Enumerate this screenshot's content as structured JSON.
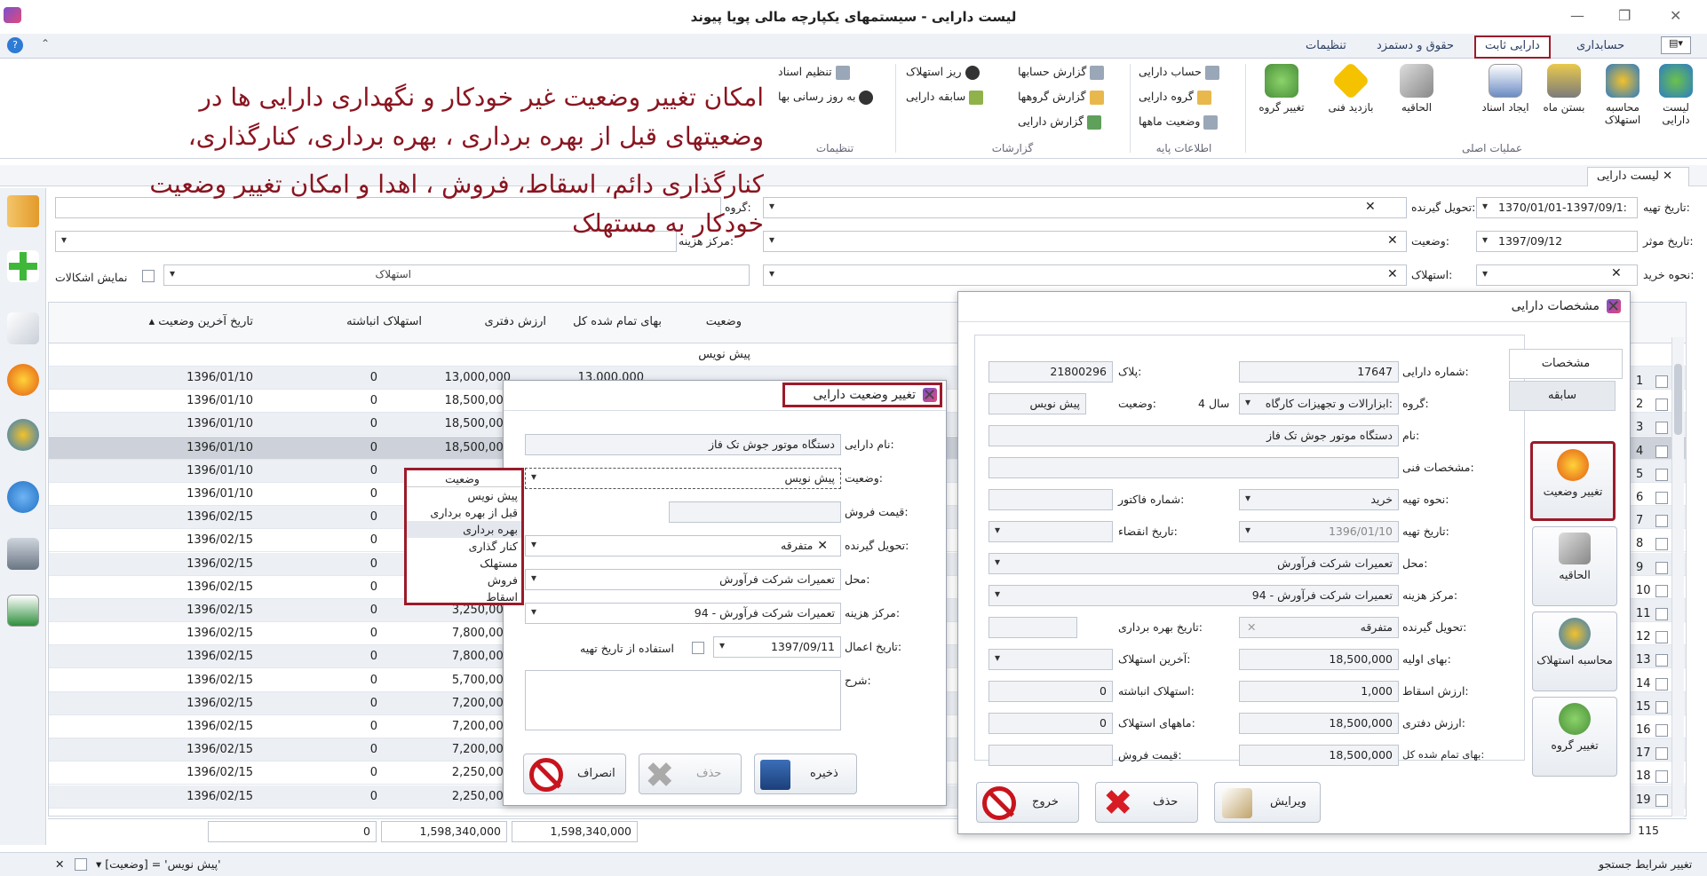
{
  "window": {
    "title": "لیست دارایی - سیستمهای یکپارچه مالی پویا پیوند"
  },
  "menu": {
    "tabs": [
      "حسابداری",
      "دارایی ثابت",
      "حقوق و دستمزد",
      "تنظیمات"
    ]
  },
  "ribbon": {
    "main_ops": [
      "لیست دارایی",
      "محاسبه استهلاک",
      "بستن ماه",
      "ایجاد اسناد",
      "الحاقیه",
      "بازدید فنی",
      "تغییر گروه"
    ],
    "main_ops_label": "عملیات اصلی",
    "base_info": [
      "حساب دارایی",
      "گروه دارایی",
      "وضعیت ماهها"
    ],
    "base_info_label": "اطلاعات پایه",
    "reports": [
      "گزارش حسابها",
      "گزارش گروهها",
      "گزارش دارایی",
      "ریز استهلاک",
      "سابقه دارایی"
    ],
    "reports_label": "گزارشات",
    "settings": [
      "تنظیم اسناد",
      "به روز رسانی بها"
    ],
    "settings_label": "تنظیمات"
  },
  "doc_tab": "لیست دارایی",
  "filters": {
    "prep_date_label": "تاریخ تهیه:",
    "prep_date": "1370/01/01-1397/09/1:",
    "effective_date_label": "تاریخ موثر:",
    "effective_date": "1397/09/12",
    "purchase_label": "نحوه خرید:",
    "receiver_label": "تحویل گیرنده:",
    "status_label": "وضعیت:",
    "depreciation_label": "استهلاک:",
    "group_label": "گروه:",
    "cost_center_label": "مرکز هزینه:",
    "show_issues": "نمایش اشکالات",
    "depreciation_text": "استهلاک"
  },
  "annotation": [
    "امکان تغییر وضعیت  غیر خودکار و نگهداری دارایی ها در",
    "وضعیتهای قبل از بهره برداری ، بهره برداری، کنارگذاری،",
    "کنارگذاری دائم، اسقاط، فروش ، اهدا و امکان تغییر وضعیت",
    "خودکار به مستهلک"
  ],
  "grid": {
    "headers": {
      "last_status_date": "تاریخ آخرین وضعیت",
      "acc_depr": "استهلاک انباشته",
      "book_value": "ارزش دفتری",
      "total_cost": "بهای تمام شده کل",
      "status": "وضعیت"
    },
    "filter_row_status": "پیش نویس",
    "rows": [
      {
        "n": "1",
        "date": "1396/01/10",
        "acc": "0",
        "book": "13,000,000",
        "cost": "13,000,000"
      },
      {
        "n": "2",
        "date": "1396/01/10",
        "acc": "0",
        "book": "18,500,000",
        "cost": ""
      },
      {
        "n": "3",
        "date": "1396/01/10",
        "acc": "0",
        "book": "18,500,000",
        "cost": ""
      },
      {
        "n": "4",
        "date": "1396/01/10",
        "acc": "0",
        "book": "18,500,000",
        "cost": ""
      },
      {
        "n": "5",
        "date": "1396/01/10",
        "acc": "0",
        "book": "8",
        "cost": ""
      },
      {
        "n": "6",
        "date": "1396/01/10",
        "acc": "0",
        "book": "8",
        "cost": ""
      },
      {
        "n": "7",
        "date": "1396/02/15",
        "acc": "0",
        "book": "19",
        "cost": ""
      },
      {
        "n": "8",
        "date": "1396/02/15",
        "acc": "0",
        "book": "3",
        "cost": ""
      },
      {
        "n": "9",
        "date": "1396/02/15",
        "acc": "0",
        "book": "3",
        "cost": ""
      },
      {
        "n": "10",
        "date": "1396/02/15",
        "acc": "0",
        "book": "3",
        "cost": ""
      },
      {
        "n": "11",
        "date": "1396/02/15",
        "acc": "0",
        "book": "3,250,000",
        "cost": ""
      },
      {
        "n": "12",
        "date": "1396/02/15",
        "acc": "0",
        "book": "7,800,000",
        "cost": ""
      },
      {
        "n": "13",
        "date": "1396/02/15",
        "acc": "0",
        "book": "7,800,000",
        "cost": ""
      },
      {
        "n": "14",
        "date": "1396/02/15",
        "acc": "0",
        "book": "5,700,000",
        "cost": ""
      },
      {
        "n": "15",
        "date": "1396/02/15",
        "acc": "0",
        "book": "7,200,000",
        "cost": ""
      },
      {
        "n": "16",
        "date": "1396/02/15",
        "acc": "0",
        "book": "7,200,000",
        "cost": ""
      },
      {
        "n": "17",
        "date": "1396/02/15",
        "acc": "0",
        "book": "7,200,000",
        "cost": ""
      },
      {
        "n": "18",
        "date": "1396/02/15",
        "acc": "0",
        "book": "2,250,000",
        "cost": ""
      },
      {
        "n": "19",
        "date": "1396/02/15",
        "acc": "0",
        "book": "2,250,000",
        "cost": "2,250,000",
        "status": "پیش نویس"
      }
    ],
    "totals": {
      "acc": "0",
      "book": "1,598,340,000",
      "cost": "1,598,340,000",
      "count": "115"
    }
  },
  "status_bar": {
    "filter": "[وضعیت] = 'پیش نویس'",
    "edit": "تغییر شرایط جستجو"
  },
  "change_dialog": {
    "title": "تغییر وضعیت دارایی",
    "name_label": "نام دارایی:",
    "name": "دستگاه موتور جوش تک فاز",
    "status_label": "وضعیت:",
    "status": "پیش نویس",
    "sale_label": "قیمت فروش:",
    "receiver_label": "تحویل گیرنده:",
    "receiver": "متفرقه",
    "location_label": "محل:",
    "location": "تعمیرات شرکت فرآورش",
    "cost_center_label": "مرکز هزینه:",
    "cost_center": "تعمیرات شرکت فرآورش - 94",
    "date_label": "تاریخ اعمال:",
    "date": "1397/09/11",
    "use_prep_date": "استفاده از تاریخ تهیه",
    "desc_label": "شرح:",
    "save": "ذخیره",
    "delete": "حذف",
    "cancel": "انصراف"
  },
  "status_list": {
    "header": "وضعیت",
    "items": [
      "پیش نویس",
      "قبل از بهره برداری",
      "بهره برداری",
      "کنار گذاری",
      "مستهلک",
      "فروش",
      "اسقاط"
    ]
  },
  "detail_dialog": {
    "title": "مشخصات دارایی",
    "tabs": [
      "مشخصات",
      "سابقه"
    ],
    "side_buttons": [
      "تغییر وضعیت",
      "الحاقیه",
      "محاسبه استهلاک",
      "تغییر گروه"
    ],
    "asset_no_label": "شماره دارایی:",
    "asset_no": "17647",
    "plate_label": "پلاک:",
    "plate": "21800296",
    "group_label": "گروه:",
    "group": "ابزارالات و تجهیزات کارگاه:",
    "years": "4 سال",
    "status_label": "وضعیت:",
    "status": "پیش نویس",
    "name_label": "نام:",
    "name": "دستگاه موتور جوش تک فاز",
    "tech_label": "مشخصات فنی:",
    "prep_method_label": "نحوه تهیه:",
    "prep_method": "خرید",
    "invoice_label": "شماره فاکتور:",
    "prep_date_label": "تاریخ تهیه:",
    "prep_date": "1396/01/10",
    "expiry_label": "تاریخ انقضاء:",
    "location_label": "محل:",
    "location": "تعمیرات شرکت فرآورش",
    "cost_center_label": "مرکز هزینه:",
    "cost_center": "تعمیرات شرکت فرآورش - 94",
    "receiver_label": "تحویل گیرنده:",
    "receiver": "متفرقه",
    "op_date_label": "تاریخ بهره برداری:",
    "initial_label": "بهای اولیه:",
    "initial": "18,500,000",
    "last_depr_label": "آخرین استهلاک:",
    "scrap_label": "ارزش اسقاط:",
    "scrap": "1,000",
    "acc_label": "استهلاک انباشته:",
    "acc": "0",
    "book_label": "ارزش دفتری:",
    "book": "18,500,000",
    "months_label": "ماههای استهلاک:",
    "months": "0",
    "total_label": "بهای تمام شده کل:",
    "total": "18,500,000",
    "sale_label": "قیمت فروش:",
    "edit": "ویرایش",
    "delete": "حذف",
    "exit": "خروج"
  }
}
